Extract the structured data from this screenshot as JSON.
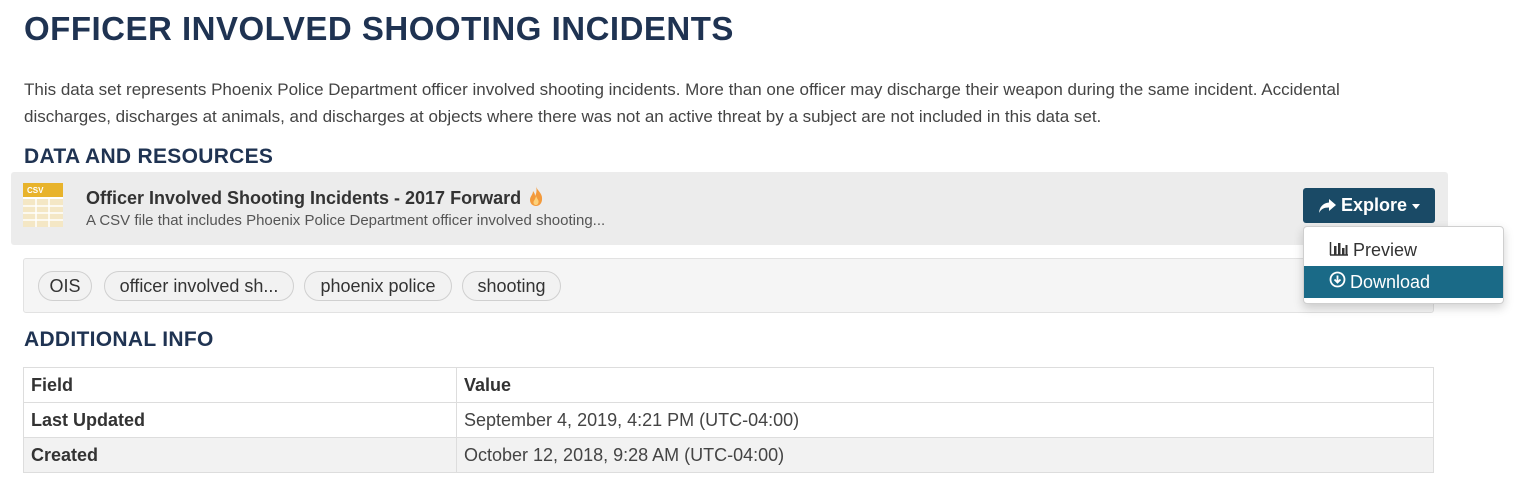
{
  "page": {
    "title": "OFFICER INVOLVED SHOOTING INCIDENTS",
    "description": "This data set represents Phoenix Police Department officer involved shooting incidents. More than one officer may discharge their weapon during the same incident. Accidental discharges, discharges at animals, and discharges at objects where there was not an active threat by a subject are not included in this data set."
  },
  "data_resources": {
    "heading": "DATA AND RESOURCES",
    "resource": {
      "format_label": "CSV",
      "title": "Officer Involved Shooting Incidents - 2017 Forward",
      "description": "A CSV file that includes Phoenix Police Department officer involved shooting...",
      "icon": "csv-file-icon",
      "popular_icon": "flame-icon"
    },
    "explore": {
      "label": "Explore",
      "icon": "share-icon",
      "menu": {
        "preview_label": "Preview",
        "preview_icon": "bar-chart-icon",
        "download_label": "Download",
        "download_icon": "download-circle-icon"
      }
    }
  },
  "tags": [
    "OIS",
    "officer involved sh...",
    "phoenix police",
    "shooting"
  ],
  "additional_info": {
    "heading": "ADDITIONAL INFO",
    "columns": {
      "field": "Field",
      "value": "Value"
    },
    "rows": [
      {
        "field": "Last Updated",
        "value": "September 4, 2019, 4:21 PM (UTC-04:00)"
      },
      {
        "field": "Created",
        "value": "October 12, 2018, 9:28 AM (UTC-04:00)"
      }
    ]
  },
  "colors": {
    "heading": "#1f3352",
    "button": "#1a4a66",
    "highlight": "#1a6a87"
  }
}
